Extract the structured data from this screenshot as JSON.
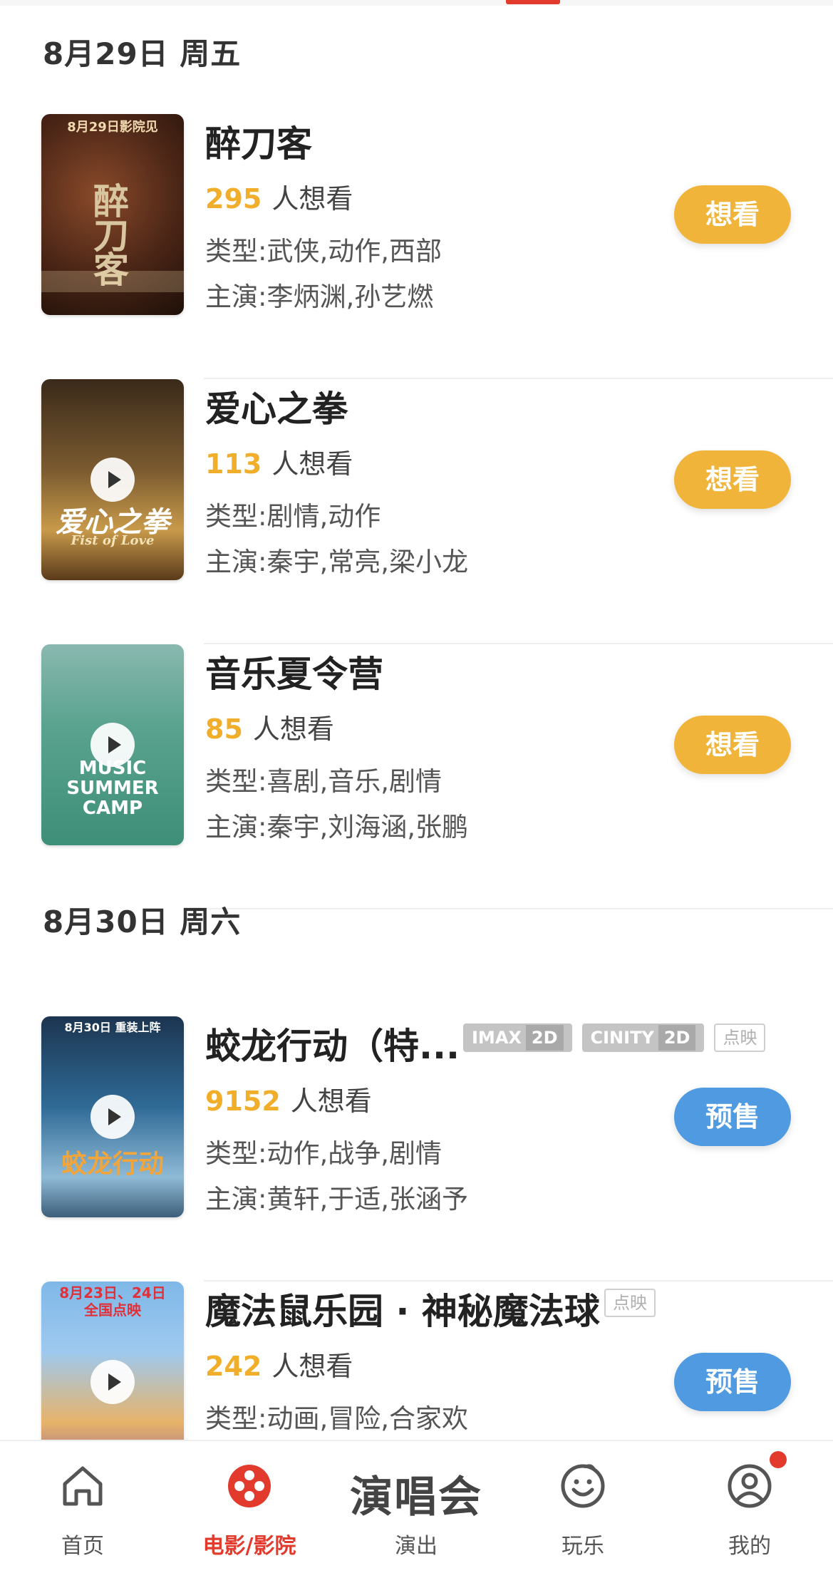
{
  "colors": {
    "accent_red": "#e23b2e",
    "want_yellow": "#f0b43a",
    "wish_count": "#f0ae2b",
    "presale_blue": "#4f9ae0"
  },
  "sections": [
    {
      "date": "8月29日 周五",
      "movies": [
        {
          "title": "醉刀客",
          "wish_count": "295",
          "wish_label": "人想看",
          "genre": "类型:武侠,动作,西部",
          "cast": "主演:李炳渊,孙艺燃",
          "button": "想看",
          "poster_text": "醉刀客",
          "poster_top": "8月29日影院见",
          "has_play": false
        },
        {
          "title": "爱心之拳",
          "wish_count": "113",
          "wish_label": "人想看",
          "genre": "类型:剧情,动作",
          "cast": "主演:秦宇,常亮,梁小龙",
          "button": "想看",
          "poster_text": "爱心之拳",
          "poster_sub": "Fist of Love",
          "has_play": true
        },
        {
          "title": "音乐夏令营",
          "wish_count": "85",
          "wish_label": "人想看",
          "genre": "类型:喜剧,音乐,剧情",
          "cast": "主演:秦宇,刘海涵,张鹏",
          "button": "想看",
          "poster_text": "MUSIC SUMMER CAMP",
          "has_play": true
        }
      ]
    },
    {
      "date": "8月30日 周六",
      "movies": [
        {
          "title": "蛟龙行动（特...",
          "wish_count": "9152",
          "wish_label": "人想看",
          "genre": "类型:动作,战争,剧情",
          "cast": "主演:黄轩,于适,张涵予",
          "button": "预售",
          "tags": [
            "IMAX",
            "2D",
            "CINITY",
            "2D",
            "点映"
          ],
          "poster_text": "蛟龙行动",
          "poster_top": "8月30日 重装上阵",
          "has_play": true
        },
        {
          "title": "魔法鼠乐园 · 神秘魔法球",
          "wish_count": "242",
          "wish_label": "人想看",
          "genre": "类型:动画,冒险,合家欢",
          "button": "预售",
          "tags": [
            "点映"
          ],
          "poster_top": "8月23日、24日 全国点映",
          "has_play": true
        }
      ]
    }
  ],
  "bottom_nav": {
    "home": {
      "label": "首页",
      "icon": "home-icon"
    },
    "movies": {
      "label": "电影/影院",
      "icon": "film-reel-icon"
    },
    "shows": {
      "label": "演出",
      "banner": "演唱会"
    },
    "fun": {
      "label": "玩乐",
      "icon": "smile-icon"
    },
    "mine": {
      "label": "我的",
      "icon": "user-icon"
    }
  }
}
